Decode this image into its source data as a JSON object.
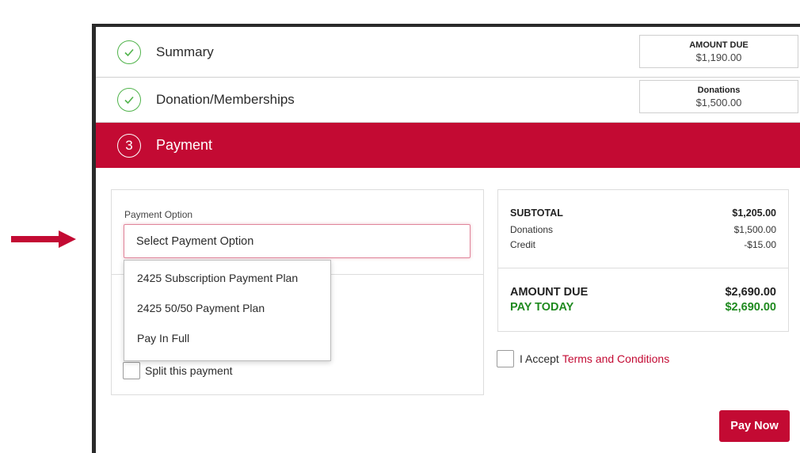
{
  "colors": {
    "accent": "#c30a33",
    "success": "#4fb34a",
    "pay_today": "#1f8a1f"
  },
  "steps": {
    "summary": {
      "title": "Summary",
      "icon": "check-circle-icon"
    },
    "donation": {
      "title": "Donation/Memberships",
      "icon": "check-circle-icon"
    },
    "payment": {
      "number": "3",
      "title": "Payment"
    }
  },
  "summary_boxes": {
    "amount_due": {
      "label": "AMOUNT DUE",
      "value": "$1,190.00"
    },
    "donations": {
      "label": "Donations",
      "value": "$1,500.00"
    }
  },
  "payment_option": {
    "label": "Payment Option",
    "selected": "Select Payment Option",
    "options": [
      "2425 Subscription Payment Plan",
      "2425 50/50 Payment Plan",
      "Pay In Full"
    ]
  },
  "split": {
    "label": "Split this payment"
  },
  "totals": {
    "subtotal": {
      "label": "SUBTOTAL",
      "value": "$1,205.00"
    },
    "donations": {
      "label": "Donations",
      "value": "$1,500.00"
    },
    "credit": {
      "label": "Credit",
      "value": "-$15.00"
    },
    "amount_due": {
      "label": "AMOUNT DUE",
      "value": "$2,690.00"
    },
    "pay_today": {
      "label": "PAY TODAY",
      "value": "$2,690.00"
    }
  },
  "terms": {
    "prefix": "I Accept",
    "link": "Terms and Conditions"
  },
  "pay_button": "Pay Now"
}
